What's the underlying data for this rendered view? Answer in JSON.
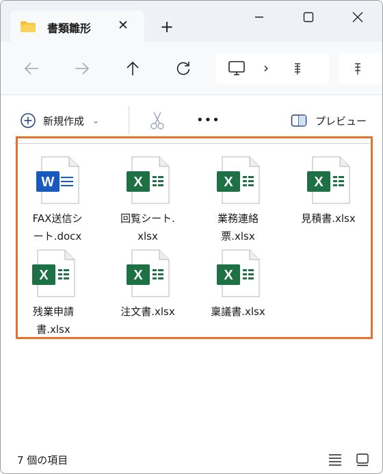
{
  "window": {
    "tab_title": "書類雛形",
    "new_tab_label": "+",
    "tab_close_label": "✕"
  },
  "address": {
    "separator": "›"
  },
  "commands": {
    "new_label": "新規作成",
    "new_chevron": "⌄",
    "more_label": "•••",
    "preview_label": "プレビュー"
  },
  "files": [
    {
      "line1": "FAX送信シ",
      "line2": "ート.docx",
      "type": "word"
    },
    {
      "line1": "回覧シート.",
      "line2": "xlsx",
      "type": "excel"
    },
    {
      "line1": "業務連絡",
      "line2": "票.xlsx",
      "type": "excel"
    },
    {
      "line1": "見積書.xlsx",
      "line2": "",
      "type": "excel"
    },
    {
      "line1": "残業申請",
      "line2": "書.xlsx",
      "type": "excel"
    },
    {
      "line1": "注文書.xlsx",
      "line2": "",
      "type": "excel"
    },
    {
      "line1": "稟議書.xlsx",
      "line2": "",
      "type": "excel"
    }
  ],
  "status": {
    "item_count": "7 個の項目"
  },
  "colors": {
    "highlight": "#e8702a",
    "excel_green": "#1e7145",
    "word_blue": "#185abd",
    "folder_yellow": "#f4c33d"
  },
  "icons": {
    "folder": "folder-icon",
    "back": "back-arrow-icon",
    "forward": "forward-arrow-icon",
    "up": "up-arrow-icon",
    "refresh": "refresh-icon",
    "computer": "computer-icon",
    "new": "plus-circle-icon",
    "cut": "scissors-icon",
    "preview": "preview-pane-icon",
    "details_view": "details-view-icon",
    "tiles_view": "tiles-view-icon"
  }
}
